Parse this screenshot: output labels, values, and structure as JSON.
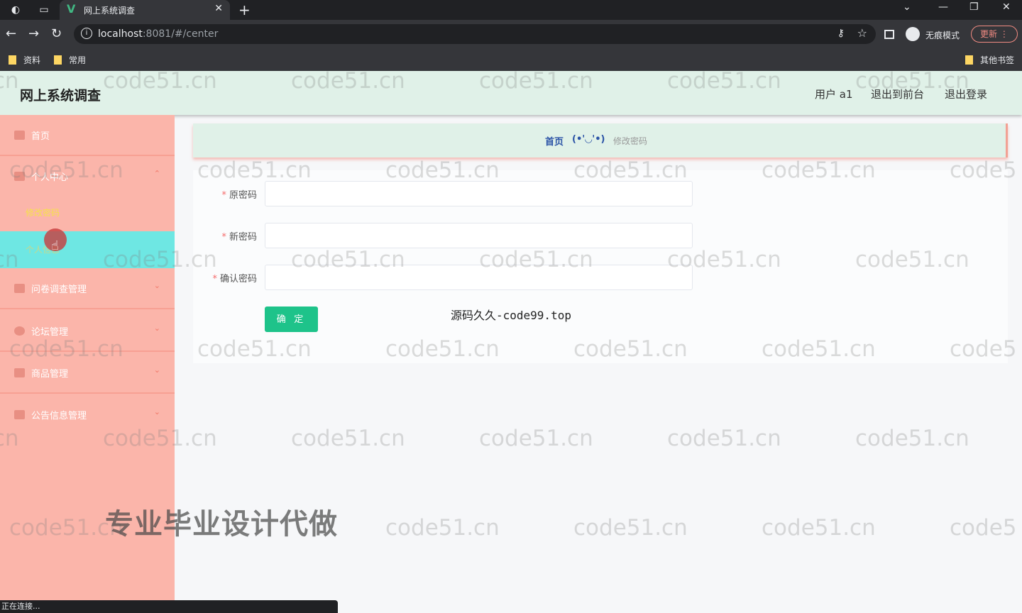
{
  "browser": {
    "tab_title": "网上系统调查",
    "url_host": "localhost",
    "url_rest": ":8081/#/center",
    "incognito_label": "无痕模式",
    "update_label": "更新",
    "bookmarks": [
      "资料",
      "常用"
    ],
    "other_bookmarks": "其他书签",
    "status_text": "正在连接..."
  },
  "header": {
    "title": "网上系统调查",
    "user": "用户 a1",
    "to_front": "退出到前台",
    "logout": "退出登录"
  },
  "sidebar": {
    "home": "首页",
    "personal_center": "个人中心",
    "change_password": "修改密码",
    "personal_info": "个人信息",
    "survey_mgmt": "问卷调查管理",
    "forum_mgmt": "论坛管理",
    "product_mgmt": "商品管理",
    "notice_mgmt": "公告信息管理"
  },
  "breadcrumb": {
    "home": "首页",
    "face": "(•'◡'•)",
    "current": "修改密码"
  },
  "form": {
    "old_password_label": "原密码",
    "new_password_label": "新密码",
    "confirm_password_label": "确认密码",
    "submit_label": "确 定"
  },
  "overlay": {
    "source_text": "源码久久-code99.top",
    "promo_text": "专业毕业设计代做",
    "watermark": "code51.cn"
  },
  "colors": {
    "header_bg": "#e0f1e8",
    "sidebar_bg": "#fbb5aa",
    "active_item_bg": "#6ee7e3",
    "submit_bg": "#1ec38a"
  }
}
